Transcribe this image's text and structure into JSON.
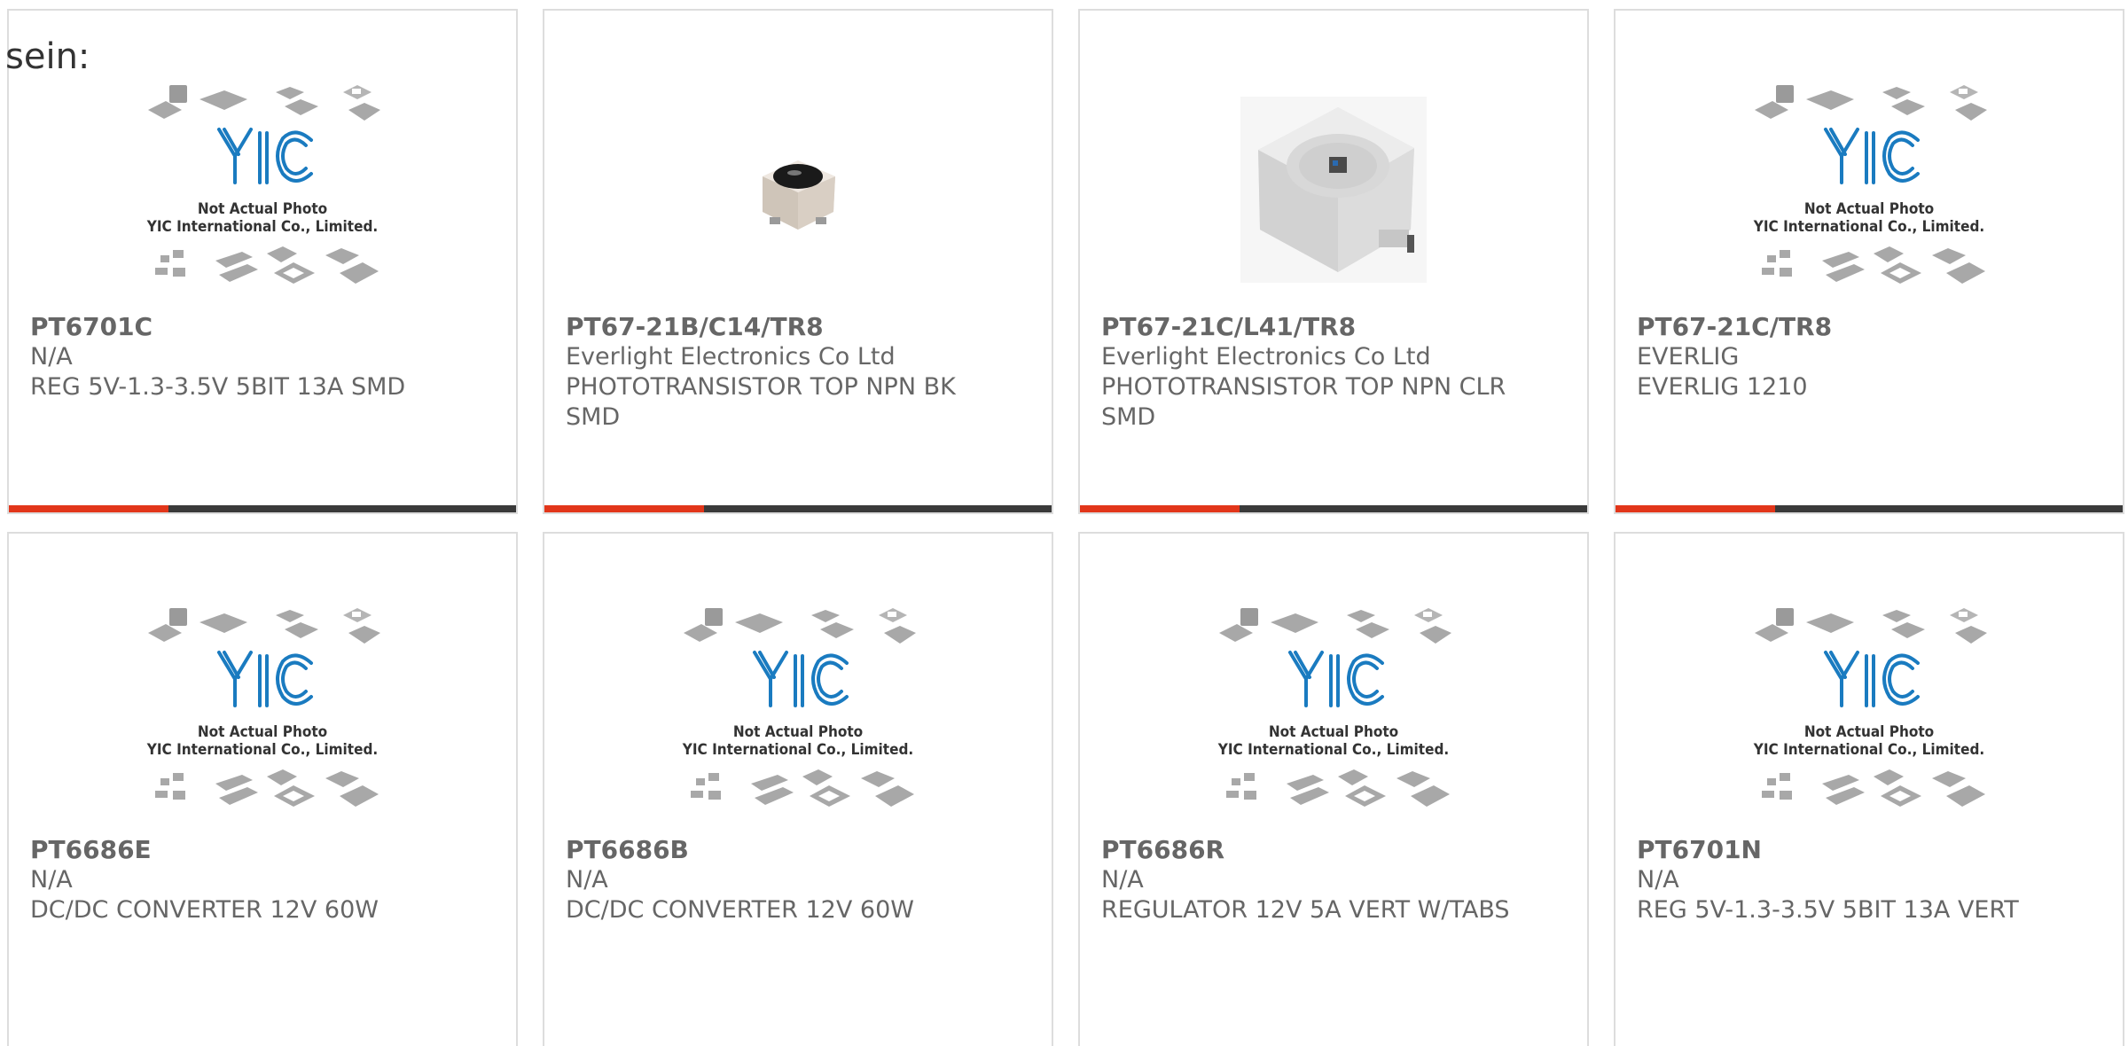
{
  "page": {
    "fragment_text": "sein:"
  },
  "placeholder": {
    "line1": "Not Actual Photo",
    "line2": "YIC International Co., Limited.",
    "logo": "YIC"
  },
  "products": [
    {
      "part": "PT6701C",
      "manufacturer": "N/A",
      "description": "REG 5V-1.3-3.5V 5BIT 13A SMD",
      "image": "placeholder-logo"
    },
    {
      "part": "PT67-21B/C14/TR8",
      "manufacturer": "Everlight Electronics Co Ltd",
      "description": "PHOTOTRANSISTOR TOP NPN BK SMD",
      "image": "phototransistor-black"
    },
    {
      "part": "PT67-21C/L41/TR8",
      "manufacturer": "Everlight Electronics Co Ltd",
      "description": "PHOTOTRANSISTOR TOP NPN CLR SMD",
      "image": "phototransistor-clear"
    },
    {
      "part": "PT67-21C/TR8",
      "manufacturer": "EVERLIG",
      "description": "EVERLIG 1210",
      "image": "placeholder-logo"
    },
    {
      "part": "PT6686E",
      "manufacturer": "N/A",
      "description": "DC/DC CONVERTER 12V 60W",
      "image": "placeholder-logo"
    },
    {
      "part": "PT6686B",
      "manufacturer": "N/A",
      "description": "DC/DC CONVERTER 12V 60W",
      "image": "placeholder-logo"
    },
    {
      "part": "PT6686R",
      "manufacturer": "N/A",
      "description": "REGULATOR 12V 5A VERT W/TABS",
      "image": "placeholder-logo"
    },
    {
      "part": "PT6701N",
      "manufacturer": "N/A",
      "description": "REG 5V-1.3-3.5V 5BIT 13A VERT",
      "image": "placeholder-logo"
    }
  ],
  "colors": {
    "accent": "#e2361a",
    "bar": "#3a3a3a",
    "border": "#dddddd",
    "text": "#666666",
    "logo": "#1a7bc0"
  }
}
